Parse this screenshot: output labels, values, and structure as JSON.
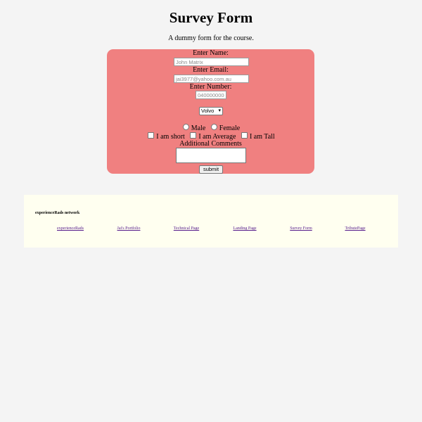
{
  "header": {
    "title": "Survey Form",
    "subtitle": "A dummy form for the course."
  },
  "form": {
    "name_label": "Enter Name:",
    "name_placeholder": "John Matrix",
    "email_label": "Enter Email:",
    "email_placeholder": "jai3977@yahoo.com.au",
    "number_label": "Enter Number:",
    "number_placeholder": "0400000000",
    "car_select_value": "Volvo",
    "gender_options": [
      "Male",
      "Female"
    ],
    "height_options": [
      "I am short",
      "I am Average",
      "I am Tall"
    ],
    "comments_label": "Additional Comments",
    "submit_label": "submit",
    "card_color": "#f08080"
  },
  "footer": {
    "title": "experienceRads network",
    "links": [
      "experienceRads",
      "Jai's Portfolio",
      "Technical Page",
      "Landing Page",
      "Survey Form",
      "TributePage"
    ],
    "background_color": "#fffff0",
    "link_color": "#551a8b"
  }
}
